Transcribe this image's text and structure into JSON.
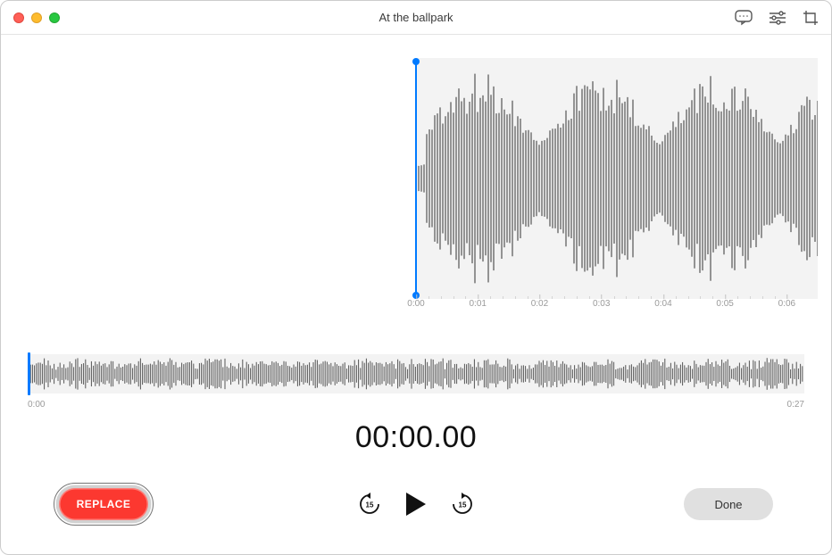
{
  "window": {
    "title": "At the ballpark"
  },
  "titlebar_icons": {
    "transcribe": "transcribe-icon",
    "settings": "playback-settings-icon",
    "trim": "trim-icon"
  },
  "main_waveform": {
    "playhead_time": "0:00",
    "ticks": [
      "0:00",
      "0:01",
      "0:02",
      "0:03",
      "0:04",
      "0:05",
      "0:06"
    ]
  },
  "overview": {
    "start_time": "0:00",
    "end_time": "0:27"
  },
  "timer": "00:00.00",
  "controls": {
    "replace_label": "REPLACE",
    "done_label": "Done",
    "skip_back_seconds": "15",
    "skip_fwd_seconds": "15"
  },
  "colors": {
    "accent": "#007aff",
    "record": "#fc3830"
  }
}
